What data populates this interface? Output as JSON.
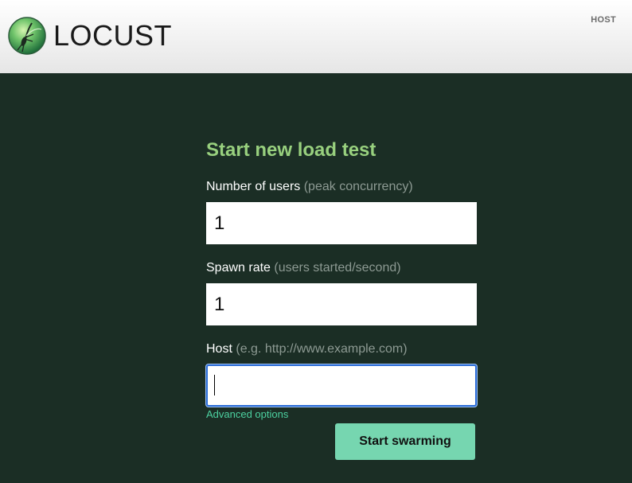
{
  "header": {
    "logo_text": "LOCUST",
    "host_label": "HOST"
  },
  "form": {
    "title": "Start new load test",
    "users": {
      "label": "Number of users",
      "hint": "(peak concurrency)",
      "value": "1"
    },
    "spawn_rate": {
      "label": "Spawn rate",
      "hint": "(users started/second)",
      "value": "1"
    },
    "host": {
      "label": "Host",
      "hint": "(e.g. http://www.example.com)",
      "value": ""
    },
    "advanced_label": "Advanced options",
    "submit_label": "Start swarming"
  },
  "colors": {
    "background": "#1b2e25",
    "title": "#98d07e",
    "hint": "#8d9a93",
    "link": "#4cd1a0",
    "button": "#76d6b0",
    "focus_border": "#2a6bd6"
  },
  "icons": {
    "logo": "locust-logo-icon"
  }
}
